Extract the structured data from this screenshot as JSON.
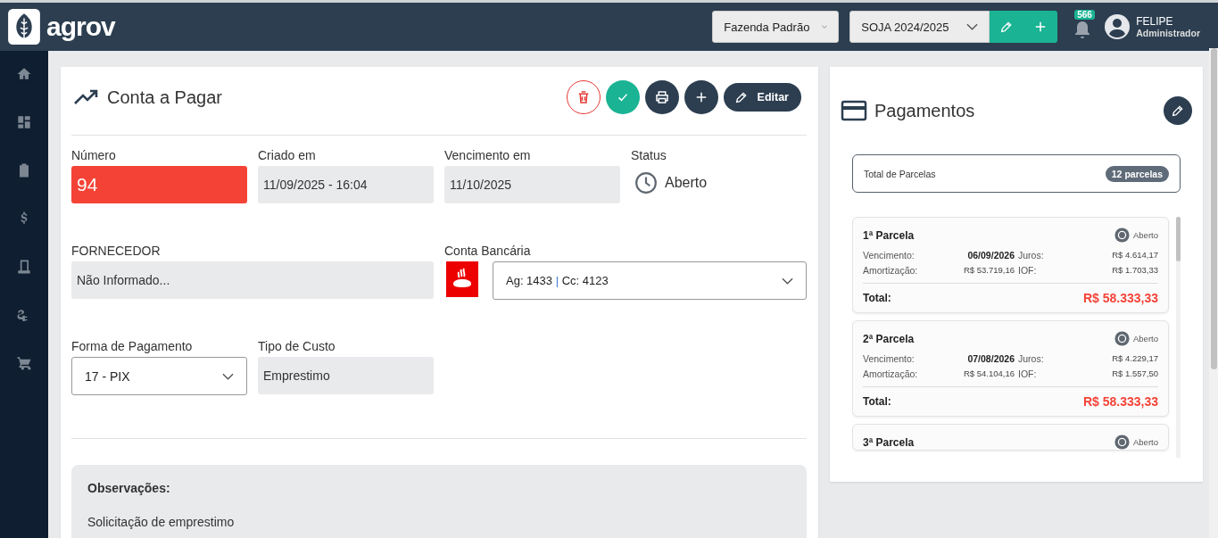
{
  "header": {
    "logo_text": "agrov",
    "farm_select": "Fazenda Padrão",
    "season_select": "SOJA 2024/2025",
    "notifications": "566",
    "user_name": "FELIPE",
    "user_role": "Administrador"
  },
  "sidebar": {
    "items": [
      {
        "kind": "home"
      },
      {
        "kind": "dashboard"
      },
      {
        "kind": "clipboard"
      },
      {
        "kind": "dollar"
      },
      {
        "kind": "register"
      },
      {
        "kind": "plug"
      },
      {
        "kind": "cart"
      }
    ]
  },
  "bill": {
    "title": "Conta a Pagar",
    "actions": [
      {
        "kind": "delete"
      },
      {
        "kind": "approve"
      },
      {
        "kind": "print"
      },
      {
        "kind": "add"
      },
      {
        "kind": "edit",
        "label": "Editar"
      }
    ],
    "fieldsets": [
      [
        {
          "kind": "readonly",
          "label": "Número",
          "value": "94",
          "highlighted": true
        },
        {
          "kind": "readonly",
          "label": "Criado em",
          "value": "11/09/2025 - 16:04",
          "highlighted": false
        },
        {
          "kind": "readonly",
          "label": "Vencimento em",
          "value": "11/10/2025",
          "highlighted": false
        },
        {
          "kind": "status",
          "label": "Status",
          "value": "Aberto"
        }
      ],
      [
        {
          "kind": "wide",
          "label": "FORNECEDOR",
          "value": "Não Informado...",
          "highlighted": false
        },
        {
          "kind": "bank",
          "label": "Conta Bancária",
          "agency": "Ag: 1433",
          "separator": "|",
          "account": "Cc: 4123"
        }
      ],
      [
        {
          "kind": "select",
          "label": "Forma de Pagamento",
          "value": "17 - PIX"
        },
        {
          "kind": "readonly",
          "label": "Tipo de Custo",
          "value": "Emprestimo",
          "highlighted": false
        }
      ]
    ],
    "notes": {
      "label": "Observações:",
      "text": "Solicitação de emprestimo"
    }
  },
  "payments": {
    "title": "Pagamentos",
    "total_label": "Total de Parcelas",
    "total_badge": "12 parcelas",
    "installments": [
      {
        "title": "1ª Parcela",
        "status": "Aberto",
        "due_label": "Vencimento:",
        "due": "06/09/2026",
        "interest_label": "Juros:",
        "interest": "R$ 4.614,17",
        "amort_label": "Amortização:",
        "amort": "R$ 53.719,16",
        "iof_label": "IOF:",
        "iof": "R$ 1.703,33",
        "total_label": "Total:",
        "total": "R$ 58.333,33"
      },
      {
        "title": "2ª Parcela",
        "status": "Aberto",
        "due_label": "Vencimento:",
        "due": "07/08/2026",
        "interest_label": "Juros:",
        "interest": "R$ 4.229,17",
        "amort_label": "Amortização:",
        "amort": "R$ 54.104,16",
        "iof_label": "IOF:",
        "iof": "R$ 1.557,50",
        "total_label": "Total:",
        "total": "R$ 58.333,33"
      },
      {
        "title": "3ª Parcela",
        "status": "Aberto"
      }
    ]
  }
}
